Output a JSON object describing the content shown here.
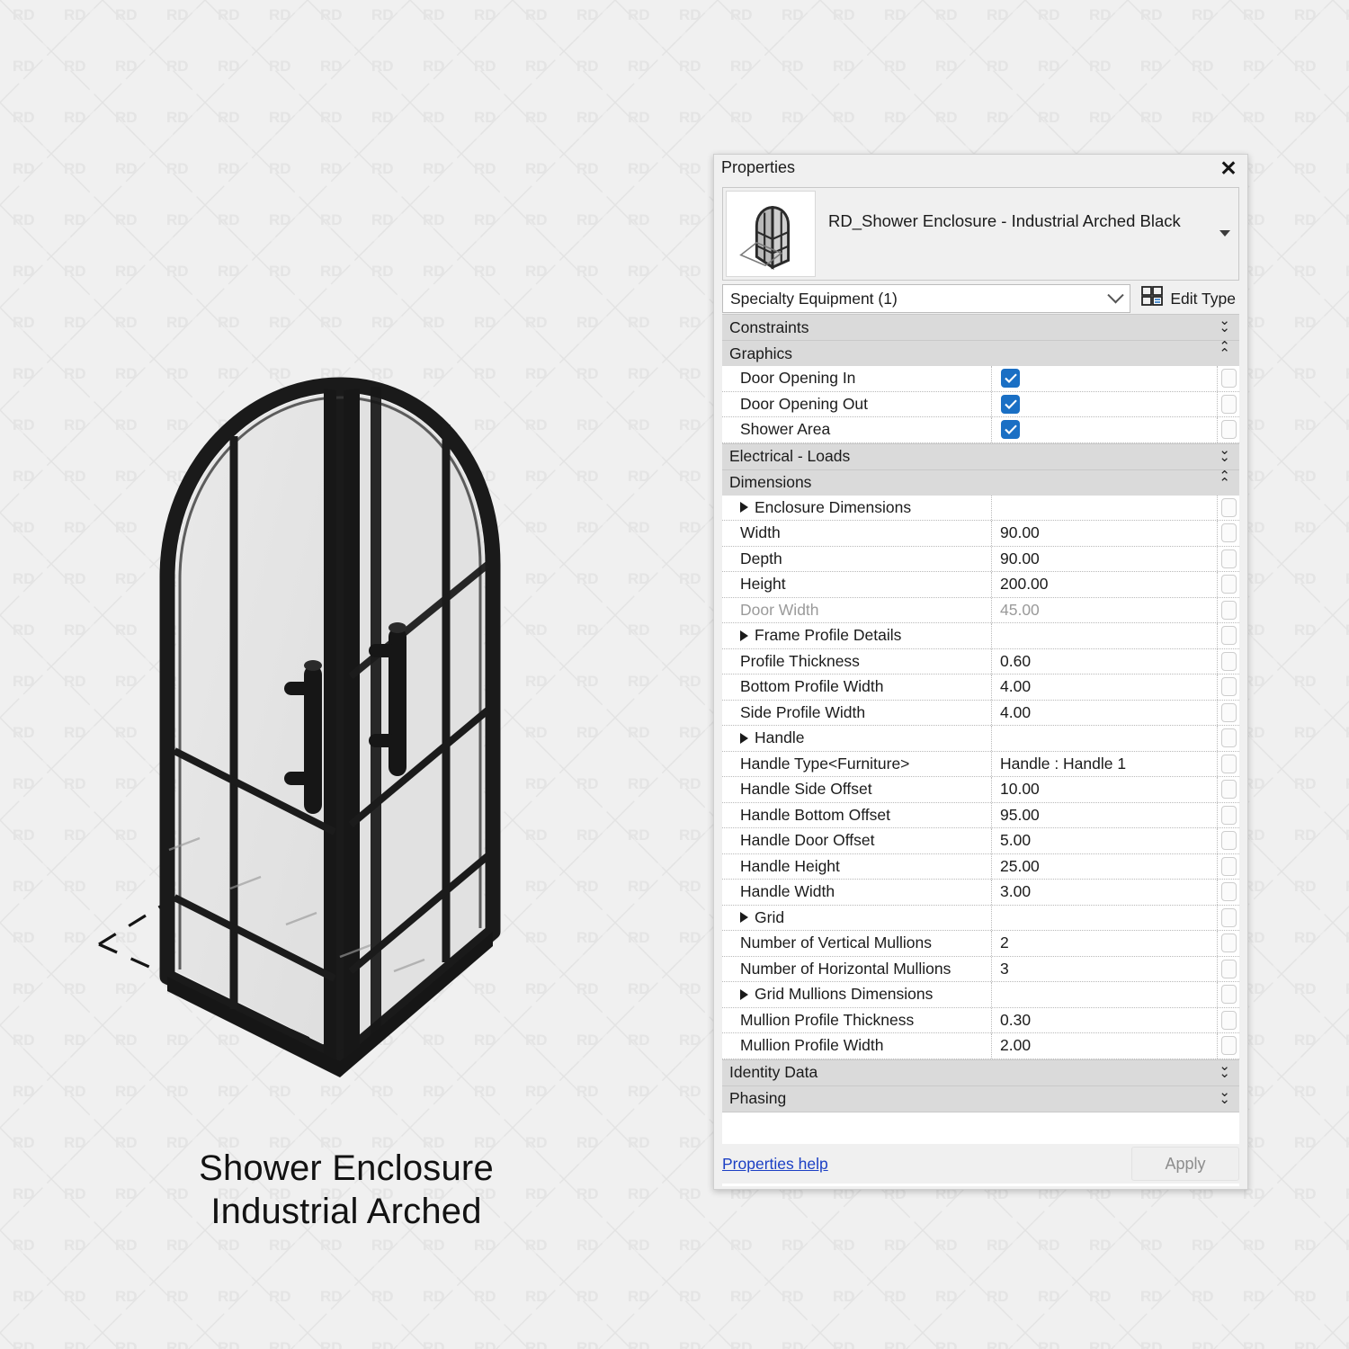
{
  "caption": {
    "line1": "Shower Enclosure",
    "line2": "Industrial Arched"
  },
  "palette": {
    "title": "Properties",
    "close_label": "✕",
    "type_name": "RD_Shower Enclosure - Industrial Arched Black",
    "category": "Specialty Equipment (1)",
    "edit_type_label": "Edit Type",
    "help_label": "Properties help",
    "apply_label": "Apply",
    "accent_checkbox": "#1a6fc4",
    "link_color": "#1b3fc4",
    "groups": [
      {
        "name": "Constraints",
        "state": "collapsed"
      },
      {
        "name": "Graphics",
        "state": "expanded"
      },
      {
        "name": "Electrical - Loads",
        "state": "collapsed"
      },
      {
        "name": "Dimensions",
        "state": "expanded"
      },
      {
        "name": "Identity Data",
        "state": "collapsed"
      },
      {
        "name": "Phasing",
        "state": "collapsed"
      }
    ],
    "graphics_rows": [
      {
        "key": "Door Opening In",
        "value": "checked"
      },
      {
        "key": "Door Opening Out",
        "value": "checked"
      },
      {
        "key": "Shower Area",
        "value": "checked"
      }
    ],
    "dimension_rows": [
      {
        "key": "Enclosure Dimensions",
        "value": "",
        "kind": "sub"
      },
      {
        "key": "Width",
        "value": "90.00",
        "kind": "value"
      },
      {
        "key": "Depth",
        "value": "90.00",
        "kind": "value"
      },
      {
        "key": "Height",
        "value": "200.00",
        "kind": "value"
      },
      {
        "key": "Door Width",
        "value": "45.00",
        "kind": "readonly"
      },
      {
        "key": "Frame Profile Details",
        "value": "",
        "kind": "sub"
      },
      {
        "key": "Profile Thickness",
        "value": "0.60",
        "kind": "value"
      },
      {
        "key": "Bottom Profile Width",
        "value": "4.00",
        "kind": "value"
      },
      {
        "key": "Side Profile Width",
        "value": "4.00",
        "kind": "value"
      },
      {
        "key": "Handle",
        "value": "",
        "kind": "sub"
      },
      {
        "key": "Handle Type<Furniture>",
        "value": "Handle : Handle 1",
        "kind": "value"
      },
      {
        "key": "Handle Side Offset",
        "value": "10.00",
        "kind": "value"
      },
      {
        "key": "Handle Bottom Offset",
        "value": "95.00",
        "kind": "value"
      },
      {
        "key": "Handle Door Offset",
        "value": "5.00",
        "kind": "value"
      },
      {
        "key": "Handle Height",
        "value": "25.00",
        "kind": "value"
      },
      {
        "key": "Handle Width",
        "value": "3.00",
        "kind": "value"
      },
      {
        "key": "Grid",
        "value": "",
        "kind": "sub"
      },
      {
        "key": "Number of Vertical Mullions",
        "value": "2",
        "kind": "value"
      },
      {
        "key": "Number of Horizontal Mullions",
        "value": "3",
        "kind": "value"
      },
      {
        "key": "Grid Mullions Dimensions",
        "value": "",
        "kind": "sub"
      },
      {
        "key": "Mullion Profile Thickness",
        "value": "0.30",
        "kind": "value"
      },
      {
        "key": "Mullion Profile Width",
        "value": "2.00",
        "kind": "value"
      }
    ]
  },
  "watermark": {
    "text": "RD"
  },
  "render": {
    "alt": "Arched industrial shower enclosure with black framed glass doors",
    "frame_color": "#1a1a1a",
    "glass_color": "#e4e4e4"
  }
}
